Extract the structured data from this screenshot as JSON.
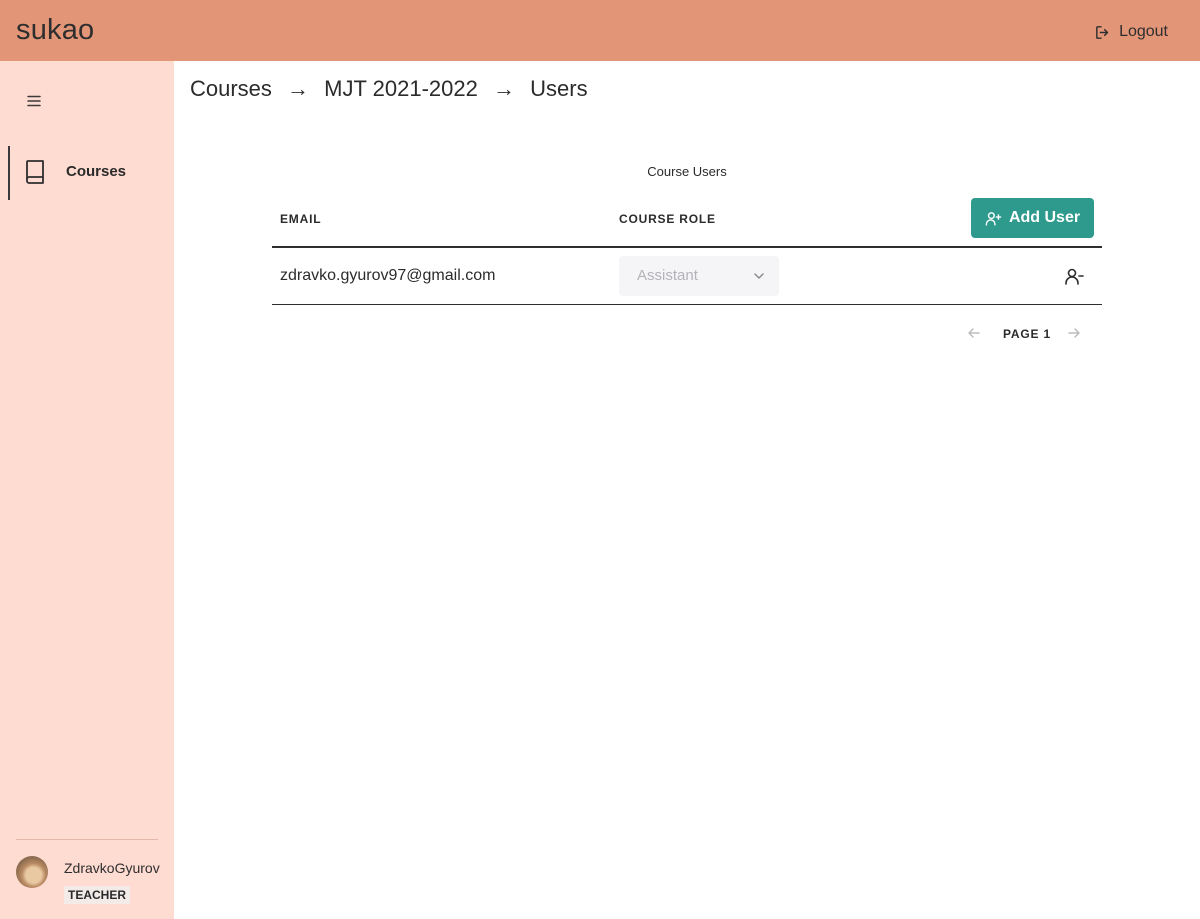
{
  "app": {
    "title": "sukao",
    "logout_label": "Logout"
  },
  "sidebar": {
    "items": [
      {
        "label": "Courses",
        "icon": "book-icon"
      }
    ],
    "user": {
      "name": "ZdravkoGyurov",
      "role": "TEACHER"
    }
  },
  "breadcrumb": {
    "items": [
      "Courses",
      "MJT 2021-2022",
      "Users"
    ],
    "separator": "→"
  },
  "table": {
    "caption": "Course Users",
    "columns": {
      "email": "EMAIL",
      "role": "COURSE ROLE"
    },
    "add_button_label": "Add User",
    "rows": [
      {
        "email": "zdravko.gyurov97@gmail.com",
        "role": "Assistant"
      }
    ]
  },
  "pagination": {
    "label": "PAGE 1"
  },
  "colors": {
    "topbar": "#e39577",
    "sidebar": "#ffdcd2",
    "accent": "#2e9a8d"
  }
}
